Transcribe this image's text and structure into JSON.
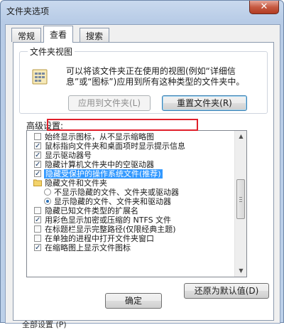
{
  "window": {
    "title": "文件夹选项",
    "close_label": "✕"
  },
  "tabs": [
    {
      "label": "常规",
      "active": false
    },
    {
      "label": "查看",
      "active": true
    },
    {
      "label": "搜索",
      "active": false
    }
  ],
  "folder_views": {
    "title": "文件夹视图",
    "description": "可以将该文件夹正在使用的视图(例如“详细信息”或“图标”)应用到所有这种类型的文件夹中。",
    "apply_button": "应用到文件夹(L)",
    "reset_button": "重置文件夹(R)"
  },
  "advanced": {
    "label": "高级设置:",
    "items": [
      {
        "type": "checkbox",
        "checked": false,
        "label": "始终显示图标，从不显示缩略图"
      },
      {
        "type": "checkbox",
        "checked": true,
        "label": "鼠标指向文件夹和桌面项时显示提示信息"
      },
      {
        "type": "checkbox",
        "checked": true,
        "label": "显示驱动器号"
      },
      {
        "type": "checkbox",
        "checked": true,
        "label": "隐藏计算机文件夹中的空驱动器"
      },
      {
        "type": "checkbox",
        "checked": true,
        "label": "隐藏受保护的操作系统文件(推荐)",
        "selected": true
      },
      {
        "type": "folder",
        "label": "隐藏文件和文件夹"
      },
      {
        "type": "radio",
        "checked": false,
        "label": "不显示隐藏的文件、文件夹或驱动器"
      },
      {
        "type": "radio",
        "checked": true,
        "label": "显示隐藏的文件、文件夹和驱动器"
      },
      {
        "type": "checkbox",
        "checked": false,
        "label": "隐藏已知文件类型的扩展名"
      },
      {
        "type": "checkbox",
        "checked": true,
        "label": "用彩色显示加密或压缩的 NTFS 文件"
      },
      {
        "type": "checkbox",
        "checked": false,
        "label": "在标题栏显示完整路径(仅限经典主题)"
      },
      {
        "type": "checkbox",
        "checked": false,
        "label": "在单独的进程中打开文件夹窗口"
      },
      {
        "type": "checkbox",
        "checked": true,
        "label": "在缩略图上显示文件图标"
      }
    ],
    "restore_button": "还原为默认值(D)"
  },
  "footer": {
    "ok_button": "确定",
    "partial_text": "全部设置 (P)"
  }
}
